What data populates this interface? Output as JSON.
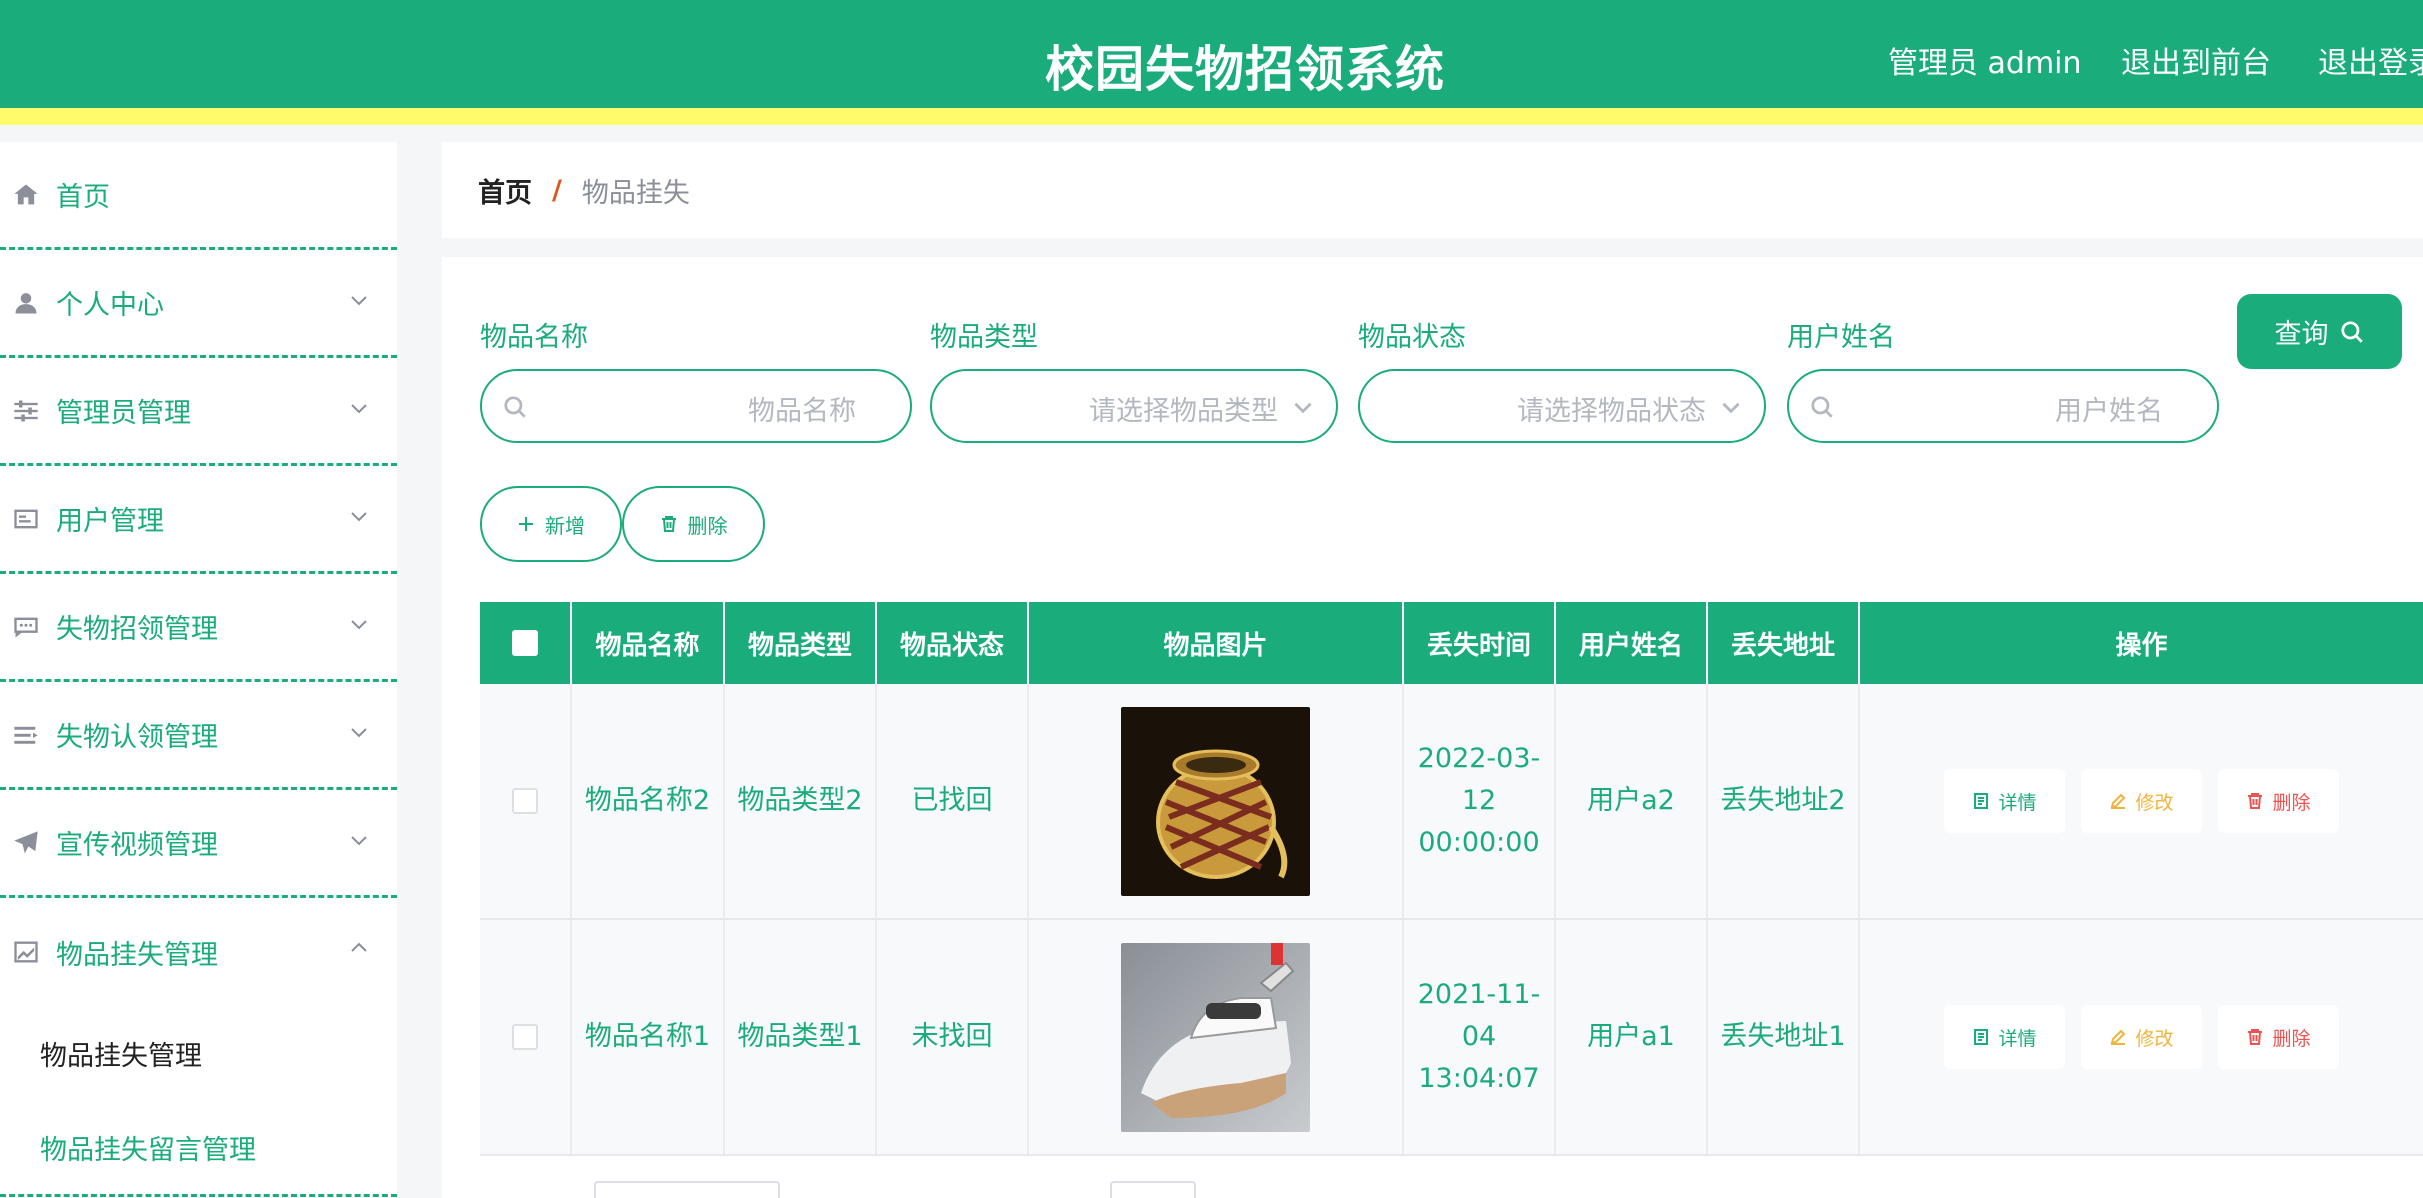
{
  "header": {
    "title": "校园失物招领系统",
    "admin_label": "管理员 admin",
    "front_label": "退出到前台",
    "logout_label": "退出登录"
  },
  "sidebar": {
    "items": [
      {
        "label": "首页",
        "icon": "home-icon"
      },
      {
        "label": "个人中心",
        "icon": "user-icon"
      },
      {
        "label": "管理员管理",
        "icon": "sliders-icon"
      },
      {
        "label": "用户管理",
        "icon": "id-card-icon"
      },
      {
        "label": "失物招领管理",
        "icon": "chat-icon"
      },
      {
        "label": "失物认领管理",
        "icon": "list-icon"
      },
      {
        "label": "宣传视频管理",
        "icon": "send-icon"
      },
      {
        "label": "物品挂失管理",
        "icon": "chart-icon"
      }
    ],
    "submenu": [
      {
        "label": "物品挂失管理"
      },
      {
        "label": "物品挂失留言管理"
      }
    ]
  },
  "breadcrumb": {
    "home": "首页",
    "separator": "/",
    "current": "物品挂失"
  },
  "search": {
    "name_label": "物品名称",
    "name_placeholder": "物品名称",
    "type_label": "物品类型",
    "type_placeholder": "请选择物品类型",
    "status_label": "物品状态",
    "status_placeholder": "请选择物品状态",
    "user_label": "用户姓名",
    "user_placeholder": "用户姓名",
    "query_label": "查询"
  },
  "actions": {
    "add_label": "新增",
    "delete_label": "删除"
  },
  "table": {
    "headers": [
      "物品名称",
      "物品类型",
      "物品状态",
      "物品图片",
      "丢失时间",
      "用户姓名",
      "丢失地址",
      "操作"
    ],
    "rows": [
      {
        "name": "物品名称2",
        "type": "物品类型2",
        "status": "已找回",
        "time": "2022-03-12 00:00:00",
        "user": "用户a2",
        "address": "丢失地址2",
        "image": "basket"
      },
      {
        "name": "物品名称1",
        "type": "物品类型1",
        "status": "未找回",
        "time": "2021-11-04 13:04:07",
        "user": "用户a1",
        "address": "丢失地址1",
        "image": "iron"
      }
    ],
    "op_detail": "详情",
    "op_edit": "修改",
    "op_delete": "删除"
  },
  "colors": {
    "primary": "#1aac7a",
    "accent_strip": "#fffb6a",
    "edit": "#f0b43c",
    "danger": "#ef5350"
  }
}
